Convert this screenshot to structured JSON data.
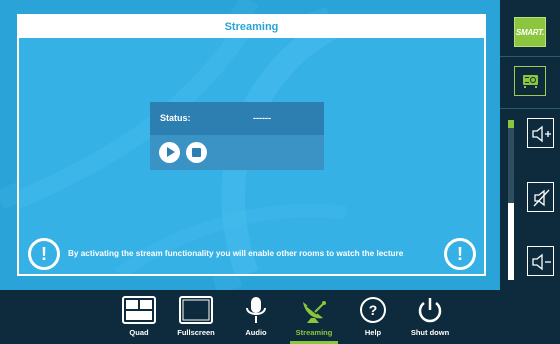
{
  "panel": {
    "title": "Streaming",
    "status_label": "Status:",
    "status_value": "------",
    "info_text": "By activating the stream functionality you will enable other rooms to watch the lecture",
    "info_icon_glyph": "!"
  },
  "sidebar": {
    "smart_label": "SMART.",
    "volume_level": 0.48
  },
  "nav": {
    "items": [
      {
        "label": "Quad",
        "icon": "quad-icon"
      },
      {
        "label": "Fullscreen",
        "icon": "fullscreen-icon"
      },
      {
        "label": "Audio",
        "icon": "microphone-icon"
      },
      {
        "label": "Streaming",
        "icon": "satellite-dish-icon",
        "active": true
      },
      {
        "label": "Help",
        "icon": "help-icon"
      },
      {
        "label": "Shut down",
        "icon": "power-icon"
      }
    ]
  },
  "colors": {
    "background_blue": "#2aa3d8",
    "panel_blue": "#35b1e6",
    "accent_green": "#8cc63f",
    "dark_navy": "#0d2b3c"
  }
}
